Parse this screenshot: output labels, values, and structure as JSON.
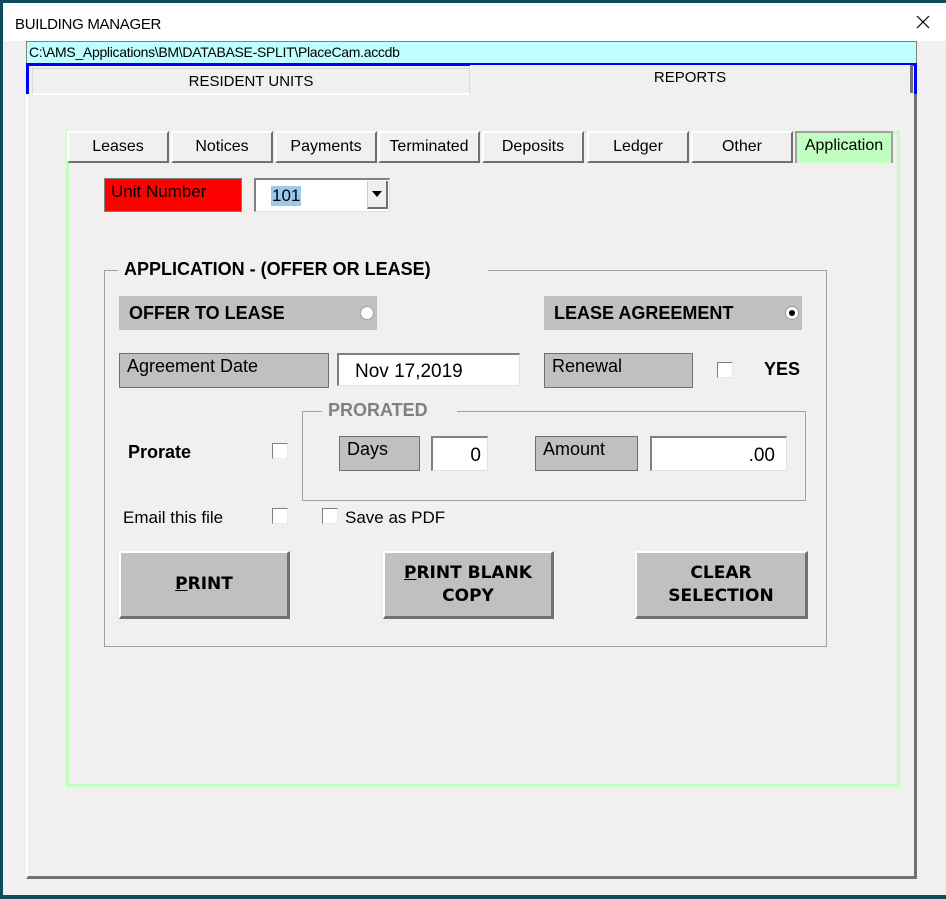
{
  "window": {
    "title": "BUILDING MANAGER",
    "close_icon": "close-icon"
  },
  "path_bar": {
    "text": "C:\\AMS_Applications\\BM\\DATABASE-SPLIT\\PlaceCam.accdb"
  },
  "main_tabs": [
    {
      "label": "RESIDENT UNITS",
      "active": false
    },
    {
      "label": "REPORTS",
      "active": true
    }
  ],
  "sub_tabs": [
    {
      "label": "Leases",
      "active": false
    },
    {
      "label": "Notices",
      "active": false
    },
    {
      "label": "Payments",
      "active": false
    },
    {
      "label": "Terminated",
      "active": false
    },
    {
      "label": "Deposits",
      "active": false
    },
    {
      "label": "Ledger",
      "active": false
    },
    {
      "label": "Other",
      "active": false
    },
    {
      "label": "Application",
      "active": true
    }
  ],
  "unit": {
    "label": "Unit Number",
    "value": "101"
  },
  "application": {
    "legend": "APPLICATION - (OFFER OR LEASE)",
    "offer_to_lease": {
      "label": "OFFER TO LEASE",
      "selected": false
    },
    "lease_agreement": {
      "label": "LEASE AGREEMENT",
      "selected": true
    },
    "agreement_date": {
      "label": "Agreement Date",
      "value": "Nov 17,2019"
    },
    "renewal": {
      "label": "Renewal",
      "checked": false,
      "yes_label": "YES"
    },
    "prorate": {
      "label": "Prorate",
      "checked": false
    },
    "prorated": {
      "legend": "PRORATED",
      "days_label": "Days",
      "days_value": "0",
      "amount_label": "Amount",
      "amount_value": ".00"
    },
    "email_file": {
      "label": "Email this file",
      "checked": false
    },
    "save_pdf": {
      "label": "Save as PDF",
      "checked": false
    },
    "buttons": {
      "print": {
        "hotkey": "P",
        "rest": "RINT"
      },
      "print_blank": {
        "hotkey": "P",
        "line1_rest": "RINT BLANK",
        "line2": "COPY"
      },
      "clear": {
        "line1": "CLEAR",
        "line2": "SELECTION"
      }
    }
  },
  "colors": {
    "path_bar_bg": "#c0ffff",
    "active_tab_bg": "#c0ffc0",
    "unit_label_bg": "#ff0000",
    "tab_outline": "#0000ff",
    "selection_highlight": "#99c9ef"
  }
}
